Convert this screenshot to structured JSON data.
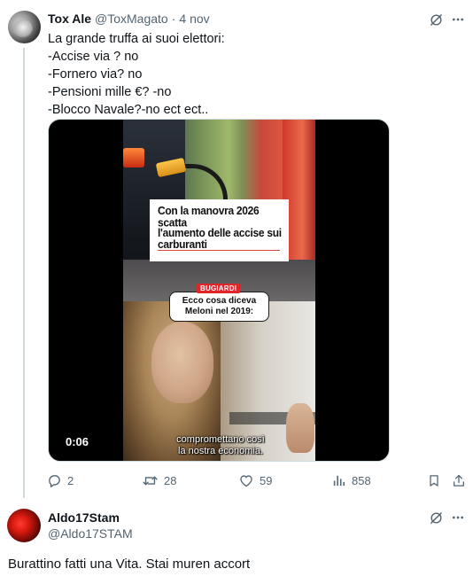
{
  "tweet": {
    "author_name": "Tox Ale",
    "author_handle": "@ToxMagato",
    "separator": "·",
    "date": "4 nov",
    "lines": [
      "La grande truffa ai suoi elettori:",
      "-Accise via ? no",
      "-Fornero via?  no",
      "-Pensioni mille €? -no",
      "-Blocco Navale?-no  ect ect.."
    ],
    "video": {
      "headline_lines": [
        "Con la manovra 2026 scatta",
        "l'aumento delle accise sui",
        "carburanti"
      ],
      "badge": "BUGIARDI",
      "bubble_lines": [
        "Ecco cosa diceva",
        "Meloni nel 2019:"
      ],
      "subtitle_lines": [
        "compromettano così",
        "la nostra economia."
      ],
      "duration": "0:06"
    },
    "stats": {
      "replies": "2",
      "reposts": "28",
      "likes": "59",
      "views": "858"
    }
  },
  "reply": {
    "author_name": "Aldo17Stam",
    "author_handle": "@Aldo17STAM",
    "text": "Burattino fatti una Vita. Stai muren accort"
  },
  "icons": {
    "grok": "grok-icon",
    "more": "more-icon",
    "reply": "reply-icon",
    "repost": "repost-icon",
    "like": "heart-icon",
    "views": "views-icon",
    "bookmark": "bookmark-icon",
    "share": "share-icon"
  },
  "colors": {
    "text": "#0f1419",
    "muted": "#536471",
    "border": "#cfd9de",
    "badge_red": "#e0262b"
  }
}
